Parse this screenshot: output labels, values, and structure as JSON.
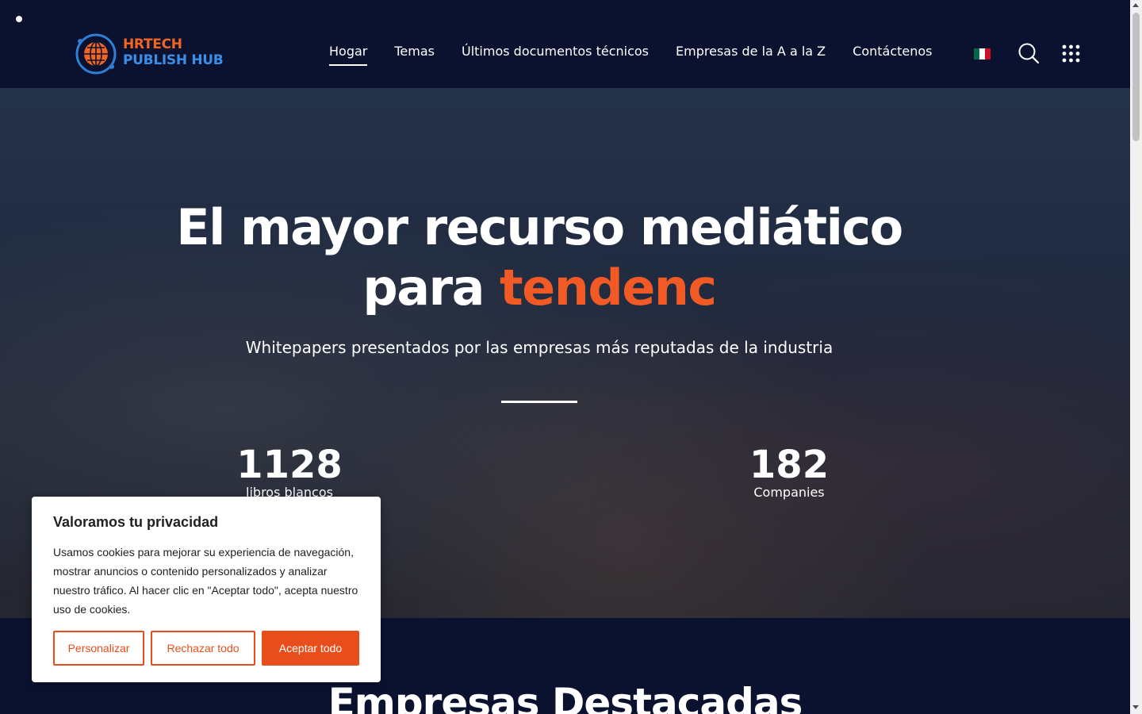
{
  "brand": {
    "line1": "HRTECH",
    "line2": "PUBLISH HUB",
    "primary": "#f26522",
    "secondary": "#3b8ee8"
  },
  "nav": {
    "items": [
      {
        "label": "Hogar",
        "active": true
      },
      {
        "label": "Temas"
      },
      {
        "label": "Últimos documentos técnicos"
      },
      {
        "label": "Empresas de la A a la Z"
      },
      {
        "label": "Contáctenos"
      }
    ],
    "language_flag": "mexico-flag-icon",
    "search_icon": "search-icon",
    "menu_icon": "grid-menu-icon"
  },
  "hero": {
    "title_line1": "El mayor recurso mediático",
    "title_line2_prefix": "para ",
    "title_line2_accent": "tendenc",
    "subtitle": "Whitepapers presentados por las empresas más reputadas de la industria",
    "stats": [
      {
        "value": "1128",
        "label": "libros blancos"
      },
      {
        "value": "182",
        "label": "Companies"
      }
    ]
  },
  "featured": {
    "title": "Empresas Destacadas"
  },
  "cookie": {
    "title": "Valoramos tu privacidad",
    "text": "Usamos cookies para mejorar su experiencia de navegación, mostrar anuncios o contenido personalizados y analizar nuestro tráfico. Al hacer clic en \"Aceptar todo\", acepta nuestro uso de cookies.",
    "customize": "Personalizar",
    "reject": "Rechazar todo",
    "accept": "Aceptar todo"
  },
  "colors": {
    "accent": "#f15a24",
    "header_bg": "#0b1230"
  }
}
